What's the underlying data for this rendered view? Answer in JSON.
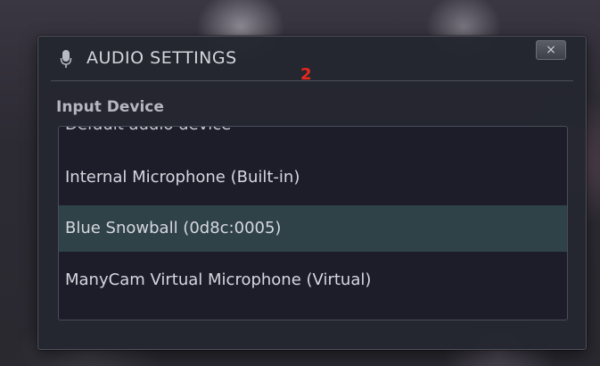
{
  "dialog": {
    "title": "AUDIO SETTINGS",
    "badge": "2",
    "close_label": "×",
    "section_label": "Input Device",
    "devices": [
      {
        "label": "Default audio device"
      },
      {
        "label": "Internal Microphone (Built-in)"
      },
      {
        "label": "Blue Snowball (0d8c:0005)",
        "selected": true
      },
      {
        "label": "ManyCam Virtual Microphone (Virtual)"
      }
    ]
  },
  "colors": {
    "selected_row": "#2f4248",
    "badge": "#e8281c",
    "dialog_bg": "#242630"
  },
  "icons": {
    "title": "microphone-icon",
    "close": "close-icon"
  }
}
